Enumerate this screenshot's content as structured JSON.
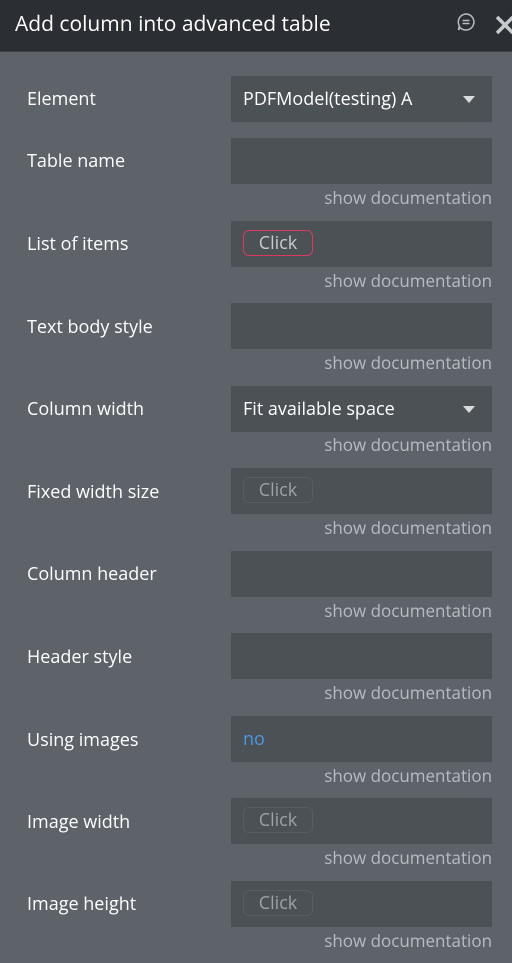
{
  "header": {
    "title": "Add column into advanced table",
    "comment_icon": "comment-icon",
    "close_icon": "close-icon"
  },
  "colors": {
    "background": "#5e6369",
    "header_background": "#2b2f33",
    "field_background": "#4c5156",
    "error_border": "#d9395e",
    "link_blue": "#4a9ae5"
  },
  "fields": [
    {
      "label": "Element",
      "type": "dropdown",
      "value": "PDFModel(testing) A"
    },
    {
      "label": "Table name",
      "type": "text",
      "value": "",
      "doc": "show documentation"
    },
    {
      "label": "List of items",
      "type": "click",
      "value": "Click",
      "error": true,
      "doc": "show documentation"
    },
    {
      "label": "Text body style",
      "type": "text",
      "value": "",
      "doc": "show documentation"
    },
    {
      "label": "Column width",
      "type": "dropdown",
      "value": "Fit available space",
      "doc": "show documentation"
    },
    {
      "label": "Fixed width size",
      "type": "click",
      "value": "Click",
      "doc": "show documentation"
    },
    {
      "label": "Column header",
      "type": "text",
      "value": "",
      "doc": "show documentation"
    },
    {
      "label": "Header style",
      "type": "text",
      "value": "",
      "doc": "show documentation"
    },
    {
      "label": "Using images",
      "type": "toggle",
      "value": "no",
      "doc": "show documentation"
    },
    {
      "label": "Image width",
      "type": "click",
      "value": "Click",
      "doc": "show documentation"
    },
    {
      "label": "Image height",
      "type": "click",
      "value": "Click",
      "doc": "show documentation"
    }
  ]
}
